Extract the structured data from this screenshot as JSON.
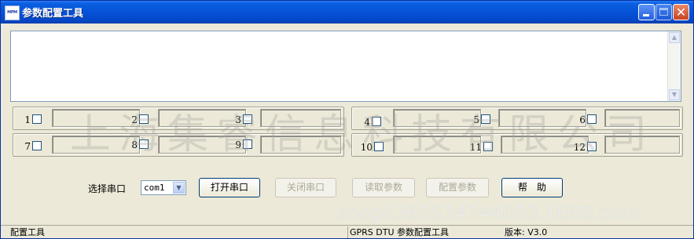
{
  "window": {
    "title": "参数配置工具",
    "icon_text": "MPM",
    "controls": [
      "minimize-icon",
      "maximize-icon",
      "close-icon"
    ]
  },
  "log_area": {
    "text": ""
  },
  "channels": [
    {
      "num": "1"
    },
    {
      "num": "2"
    },
    {
      "num": "3"
    },
    {
      "num": "4"
    },
    {
      "num": "5"
    },
    {
      "num": "6"
    },
    {
      "num": "7"
    },
    {
      "num": "8"
    },
    {
      "num": "9"
    },
    {
      "num": "10"
    },
    {
      "num": "11"
    },
    {
      "num": "12"
    }
  ],
  "controls": {
    "port_label": "选择串口",
    "port_value": "com1",
    "open_port": "打开串口",
    "close_port": "关闭串口",
    "read_params": "读取参数",
    "config_params": "配置参数",
    "help": "帮　助"
  },
  "overlay": {
    "watermark": "上海集睿信息科技有限公司",
    "shop": "shop1365574744053.1688.com"
  },
  "statusbar": {
    "left": "配置工具",
    "middle": "GPRS DTU 参数配置工具",
    "right": "版本: V3.0"
  }
}
